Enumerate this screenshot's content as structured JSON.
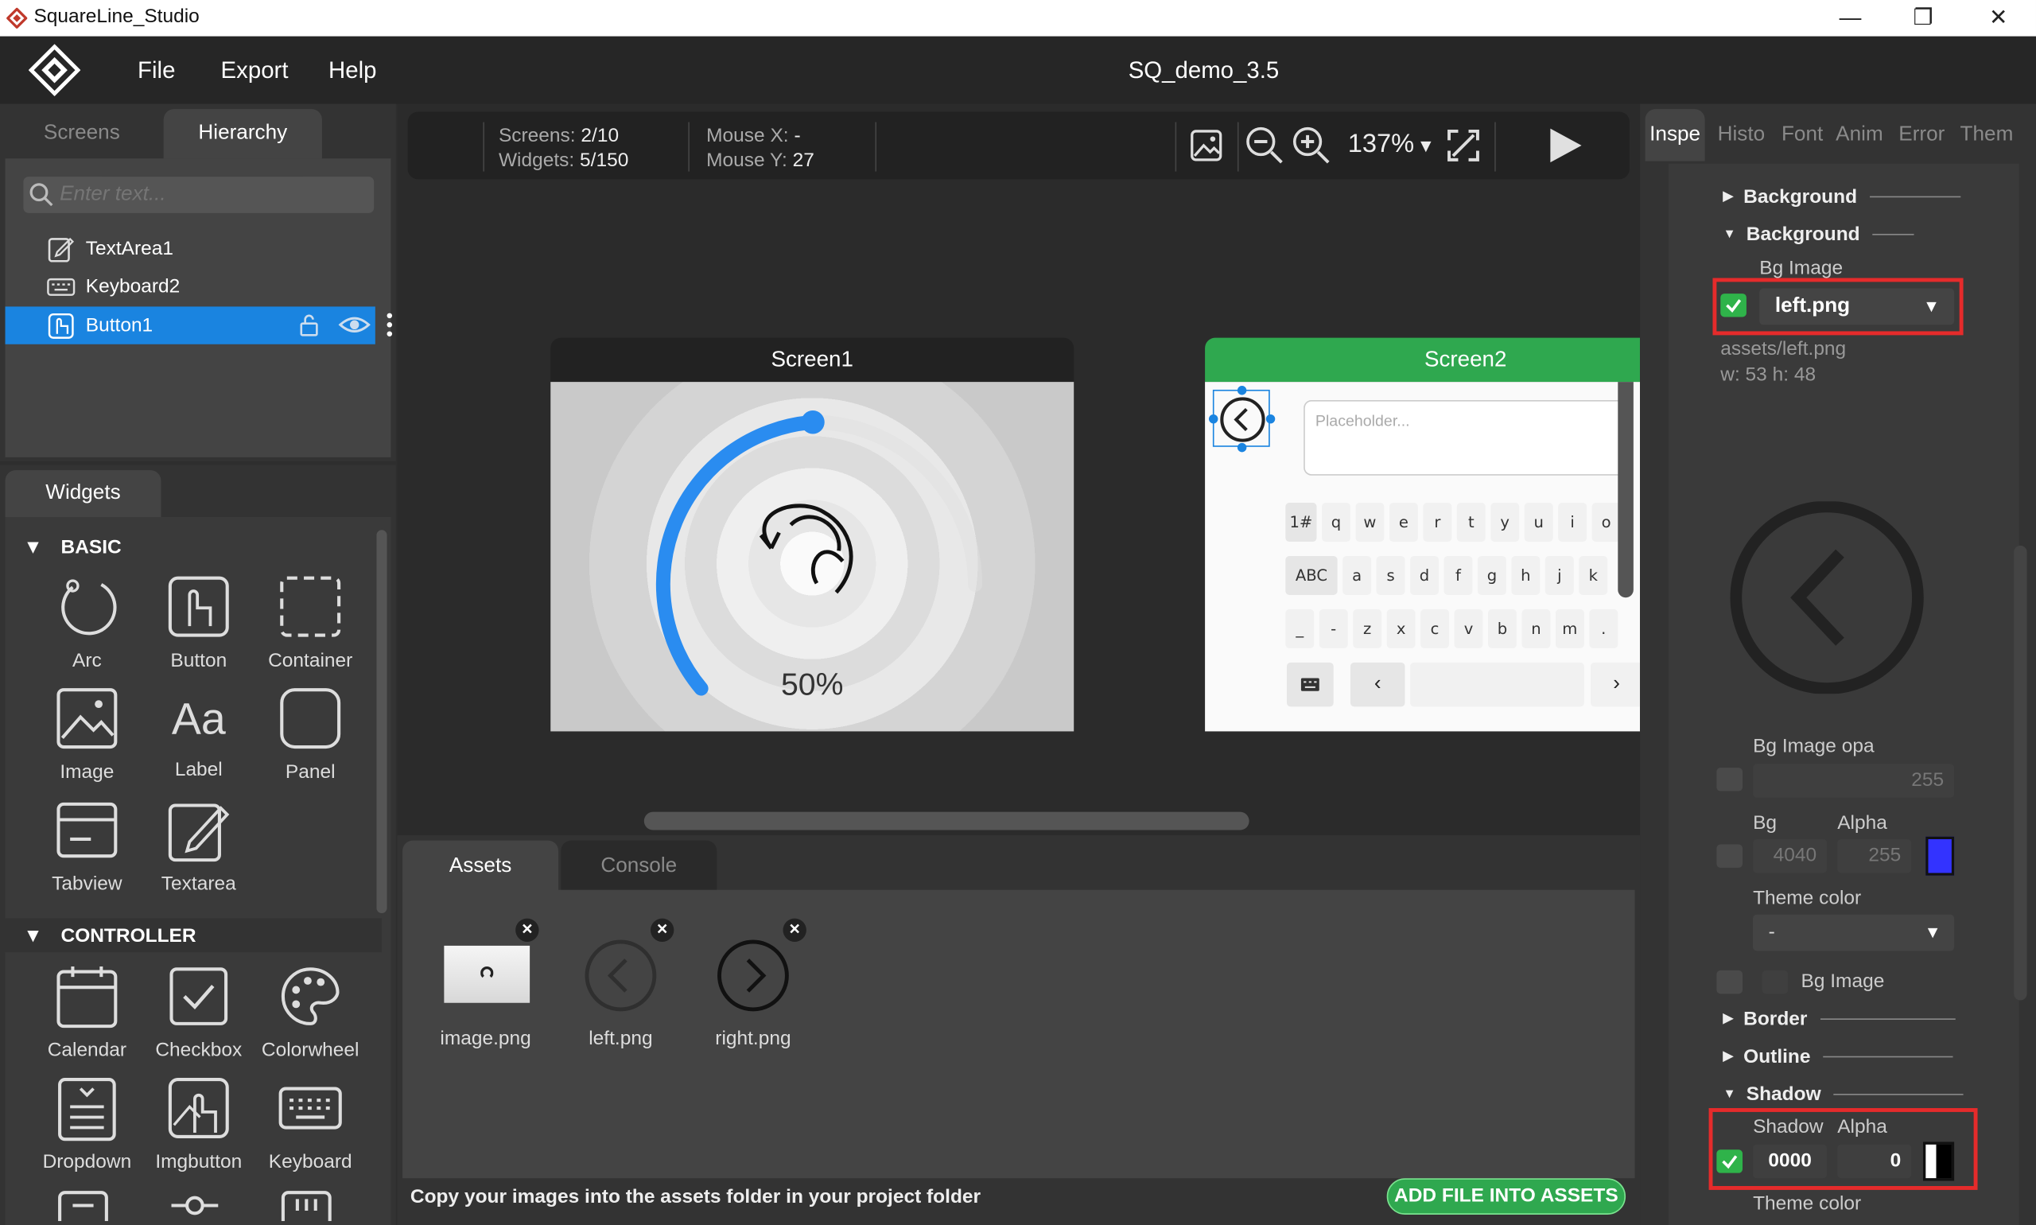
{
  "window": {
    "title": "SquareLine_Studio",
    "minimize": "—",
    "maximize": "❐",
    "close": "✕"
  },
  "menu": {
    "file": "File",
    "export": "Export",
    "help": "Help",
    "project_name": "SQ_demo_3.5"
  },
  "left_tabs": {
    "screens": "Screens",
    "hierarchy": "Hierarchy"
  },
  "search": {
    "placeholder": "Enter text..."
  },
  "hierarchy": {
    "items": [
      {
        "label": "TextArea1"
      },
      {
        "label": "Keyboard2"
      },
      {
        "label": "Button1"
      }
    ]
  },
  "widgets": {
    "tab": "Widgets",
    "basic_title": "BASIC",
    "basic": [
      "Arc",
      "Button",
      "Container",
      "Image",
      "Label",
      "Panel",
      "Tabview",
      "Textarea"
    ],
    "controller_title": "CONTROLLER",
    "controller": [
      "Calendar",
      "Checkbox",
      "Colorwheel",
      "Dropdown",
      "Imgbutton",
      "Keyboard"
    ]
  },
  "toolbar": {
    "screens_label": "Screens:",
    "screens_value": "2/10",
    "widgets_label": "Widgets:",
    "widgets_value": "5/150",
    "mouse_x_label": "Mouse X:",
    "mouse_x_value": "-",
    "mouse_y_label": "Mouse Y:",
    "mouse_y_value": "27",
    "zoom": "137%"
  },
  "screen1": {
    "title": "Screen1",
    "arc_percent": "50%",
    "arc_value": 0.5
  },
  "screen2": {
    "title": "Screen2",
    "textarea_placeholder": "Placeholder...",
    "keyboard_rows": [
      [
        "1#",
        "q",
        "w",
        "e",
        "r",
        "t",
        "y",
        "u",
        "i",
        "o"
      ],
      [
        "ABC",
        "a",
        "s",
        "d",
        "f",
        "g",
        "h",
        "j",
        "k"
      ],
      [
        "_",
        "-",
        "z",
        "x",
        "c",
        "v",
        "b",
        "n",
        "m",
        "."
      ]
    ]
  },
  "colors": {
    "accent_green": "#2fa84f",
    "selection_blue": "#1a84e0",
    "arc_blue": "#2a8cf0",
    "highlight_red": "#e52b2b",
    "bg_color_swatch": "#3333ff"
  },
  "bottom": {
    "assets_tab": "Assets",
    "console_tab": "Console",
    "assets": [
      {
        "label": "image.png"
      },
      {
        "label": "left.png"
      },
      {
        "label": "right.png"
      }
    ],
    "hint": "Copy your images into the assets folder in your project folder",
    "add_button": "ADD FILE INTO ASSETS"
  },
  "inspector": {
    "tabs": [
      "Inspe",
      "Histo",
      "Font",
      "Anim",
      "Error",
      "Them"
    ],
    "section_background_1": "Background",
    "section_background_2": "Background",
    "bg_image_label": "Bg Image",
    "bg_image_value": "left.png",
    "asset_path": "assets/left.png",
    "asset_size": "w: 53  h: 48",
    "bg_image_opa_label": "Bg Image opa",
    "bg_image_opa_value": "255",
    "bg_label": "Bg",
    "alpha_label": "Alpha",
    "bg_value": "4040",
    "bg_alpha_value": "255",
    "theme_color_label": "Theme color",
    "theme_color_value": "-",
    "bg_image_label_2": "Bg Image",
    "section_border": "Border",
    "section_outline": "Outline",
    "section_shadow": "Shadow",
    "shadow_label": "Shadow",
    "shadow_alpha_label": "Alpha",
    "shadow_value": "0000",
    "shadow_alpha_value": "0",
    "theme_color_label_2": "Theme color"
  }
}
